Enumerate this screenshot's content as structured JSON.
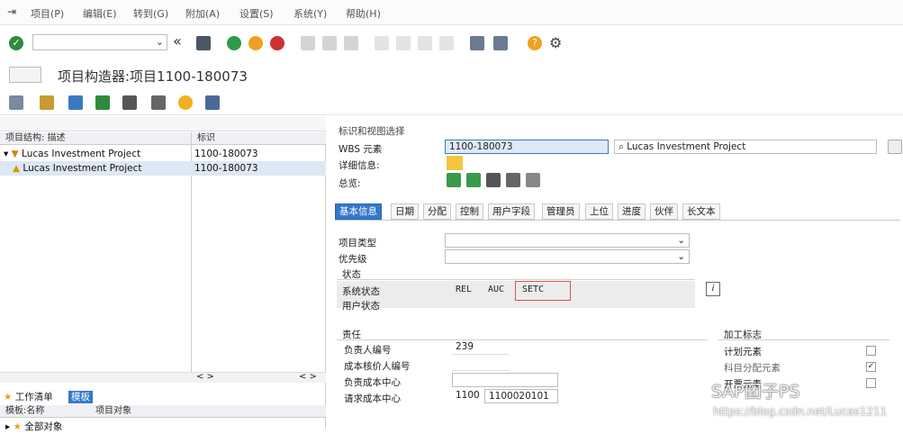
{
  "menu": [
    "项目(P)",
    "编辑(E)",
    "转到(G)",
    "附加(A)",
    "设置(S)",
    "系统(Y)",
    "帮助(H)"
  ],
  "title": "项目构造器:项目1100-180073",
  "left": {
    "col_desc": "项目结构: 描述",
    "col_id": "标识",
    "rows": [
      {
        "desc": "Lucas Investment Project",
        "id": "1100-180073"
      },
      {
        "desc": "Lucas Investment Project",
        "id": "1100-180073"
      }
    ],
    "bottom_tab1": "工作清单",
    "bottom_tab2": "模板",
    "bottom_col1": "模板:名称",
    "bottom_col2": "项目对象",
    "bottom_row1": "全部对象"
  },
  "right": {
    "section": "标识和视图选择",
    "wbs_label": "WBS 元素",
    "wbs_value": "1100-180073",
    "wbs_desc": "Lucas Investment Project",
    "detail_label": "详细信息:",
    "overview_label": "总览:",
    "tabs": [
      "基本信息",
      "日期",
      "分配",
      "控制",
      "用户字段",
      "管理员",
      "上位",
      "进度",
      "伙伴",
      "长文本"
    ],
    "project_type_label": "项目类型",
    "priority_label": "优先级",
    "status_group": "状态",
    "sys_status_label": "系统状态",
    "sys_status": [
      "REL",
      "AUC",
      "SETC"
    ],
    "user_status_label": "用户状态",
    "resp_group": "责任",
    "resp_rows": [
      {
        "label": "负责人编号",
        "value": "239"
      },
      {
        "label": "成本核价人编号",
        "value": ""
      },
      {
        "label": "负责成本中心",
        "value": ""
      },
      {
        "label": "请求成本中心",
        "value": "1100",
        "value2": "1100020101"
      }
    ],
    "proc_group": "加工标志",
    "proc_rows": [
      {
        "label": "计划元素",
        "checked": false
      },
      {
        "label": "科目分配元素",
        "checked": true
      },
      {
        "label": "开票元素",
        "checked": false
      }
    ]
  },
  "watermark1": "SAP团子PS",
  "watermark2": "https://blog.csdn.net/Lucas1211"
}
